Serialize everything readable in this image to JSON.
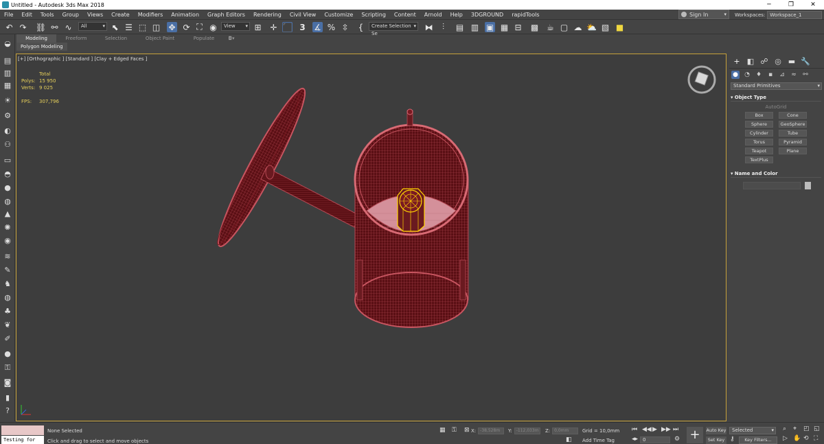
{
  "window": {
    "title": "Untitled - Autodesk 3ds Max 2018",
    "minimize": "─",
    "maximize": "❐",
    "close": "✕"
  },
  "menu": [
    "File",
    "Edit",
    "Tools",
    "Group",
    "Views",
    "Create",
    "Modifiers",
    "Animation",
    "Graph Editors",
    "Rendering",
    "Civil View",
    "Customize",
    "Scripting",
    "Content",
    "Arnold",
    "Help",
    "3DGROUND",
    "rapidTools"
  ],
  "account": {
    "sign_in": "Sign In",
    "workspaces_label": "Workspaces:",
    "workspace": "Workspace_1"
  },
  "toolbar": {
    "selection_filter": "All",
    "reference_coord": "View",
    "snap_label": "3",
    "named_selection_placeholder": "Create Selection Se"
  },
  "ribbon": {
    "tabs": [
      "Modeling",
      "Freeform",
      "Selection",
      "Object Paint",
      "Populate"
    ],
    "active_tab": "Modeling",
    "subpanel": "Polygon Modeling"
  },
  "viewport": {
    "label": "[+] [Orthographic ] [Standard ] [Clay + Edged Faces ]",
    "stats": {
      "total_label": "Total",
      "polys_label": "Polys:",
      "polys": "15 950",
      "verts_label": "Verts:",
      "verts": "9 025",
      "fps_label": "FPS:",
      "fps": "307,796"
    },
    "colors": {
      "model_fill": "#5a0f14",
      "model_edges": "#b84a55",
      "selection": "#ffd400",
      "frame": "#c8a23a"
    }
  },
  "command_panel": {
    "category": "Standard Primitives",
    "object_type_title": "Object Type",
    "autogrid": "AutoGrid",
    "buttons": [
      "Box",
      "Cone",
      "Sphere",
      "GeoSphere",
      "Cylinder",
      "Tube",
      "Torus",
      "Pyramid",
      "Teapot",
      "Plane",
      "TextPlus"
    ],
    "name_color_title": "Name and Color"
  },
  "status": {
    "selection": "None Selected",
    "prompt": "Click and drag to select and move objects",
    "listener_text": "Testing for ",
    "x_label": "X:",
    "x_value": "-38,528m",
    "y_label": "Y:",
    "y_value": "-112,033m",
    "z_label": "Z:",
    "z_value": "0,0mm",
    "grid": "Grid = 10,0mm",
    "add_time_tag": "Add Time Tag",
    "frame": "0",
    "auto_key": "Auto Key",
    "set_key": "Set Key",
    "selected": "Selected",
    "key_filters": "Key Filters..."
  }
}
